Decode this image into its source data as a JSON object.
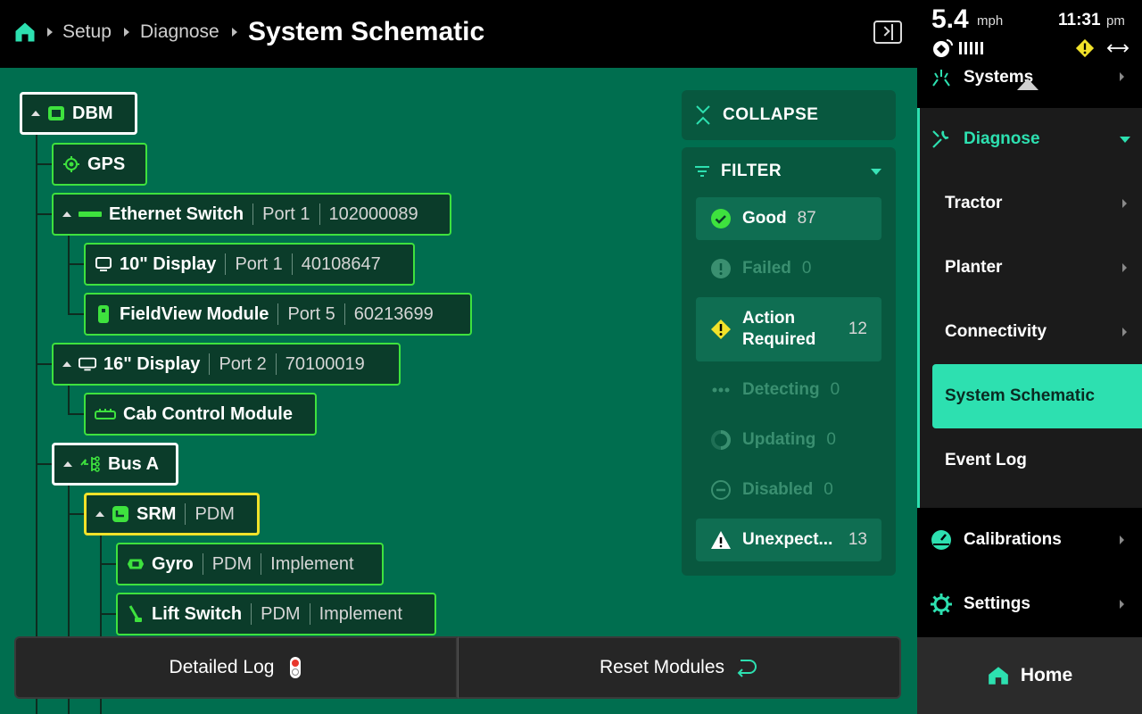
{
  "header": {
    "breadcrumbs": [
      "Setup",
      "Diagnose"
    ],
    "title": "System Schematic"
  },
  "status": {
    "speed": "5.4",
    "speed_unit": "mph",
    "time": "11:31",
    "ampm": "pm"
  },
  "tree": {
    "dbm": {
      "name": "DBM"
    },
    "gps": {
      "name": "GPS"
    },
    "ethernet": {
      "name": "Ethernet Switch",
      "port": "Port 1",
      "serial": "102000089"
    },
    "display10": {
      "name": "10\" Display",
      "port": "Port 1",
      "serial": "40108647"
    },
    "fieldview": {
      "name": "FieldView Module",
      "port": "Port 5",
      "serial": "60213699"
    },
    "display16": {
      "name": "16\" Display",
      "port": "Port 2",
      "serial": "70100019"
    },
    "cab": {
      "name": "Cab Control Module"
    },
    "busa": {
      "name": "Bus A"
    },
    "srm": {
      "name": "SRM",
      "port": "PDM"
    },
    "gyro": {
      "name": "Gyro",
      "port": "PDM",
      "serial": "Implement"
    },
    "lift": {
      "name": "Lift Switch",
      "port": "PDM",
      "serial": "Implement"
    }
  },
  "controls": {
    "collapse": "COLLAPSE",
    "filter": "FILTER"
  },
  "filters": [
    {
      "label": "Good",
      "count": "87",
      "state": "on",
      "icon": "check-circle-icon"
    },
    {
      "label": "Failed",
      "count": "0",
      "state": "off",
      "icon": "error-circle-icon"
    },
    {
      "label": "Action Required",
      "count": "12",
      "state": "on",
      "icon": "warning-diamond-icon"
    },
    {
      "label": "Detecting",
      "count": "0",
      "state": "off",
      "icon": "dots-icon"
    },
    {
      "label": "Updating",
      "count": "0",
      "state": "off",
      "icon": "progress-ring-icon"
    },
    {
      "label": "Disabled",
      "count": "0",
      "state": "off",
      "icon": "minus-circle-icon"
    },
    {
      "label": "Unexpect...",
      "count": "13",
      "state": "on",
      "icon": "warning-triangle-icon"
    }
  ],
  "buttons": {
    "detailed_log": "Detailed Log",
    "reset_modules": "Reset Modules"
  },
  "sidebar": {
    "systems": "Systems",
    "diagnose": "Diagnose",
    "sub": [
      "Tractor",
      "Planter",
      "Connectivity",
      "System Schematic",
      "Event Log"
    ],
    "calibrations": "Calibrations",
    "settings": "Settings",
    "home": "Home"
  },
  "colors": {
    "accent": "#2de0b0",
    "good_border": "#3ee23e",
    "warning": "#f1e22a",
    "main_bg": "#006e4f"
  }
}
